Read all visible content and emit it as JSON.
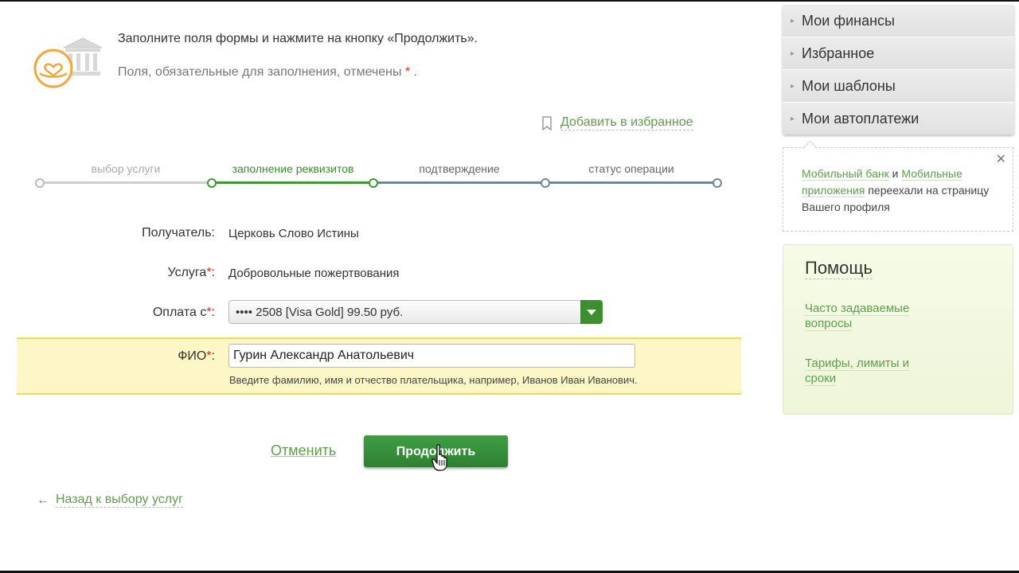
{
  "intro": {
    "line1": "Заполните поля формы и нажмите на кнопку «Продолжить».",
    "line2_prefix": "Поля, обязательные для заполнения, отмечены ",
    "line2_star": "*",
    "line2_suffix": " ."
  },
  "favorites": {
    "label": "Добавить в избранное"
  },
  "steps": [
    {
      "label": "выбор услуги",
      "state": "done"
    },
    {
      "label": "заполнение реквизитов",
      "state": "active"
    },
    {
      "label": "подтверждение",
      "state": "future"
    },
    {
      "label": "статус операции",
      "state": "future"
    }
  ],
  "form": {
    "recipient_label": "Получатель:",
    "recipient_value": "Церковь Слово Истины",
    "service_label": "Услуга",
    "service_value": "Добровольные пожертвования",
    "payment_label": "Оплата с",
    "payment_value": "•••• 2508 [Visa Gold] 99.50 руб.",
    "fio_label": "ФИО",
    "fio_value": "Гурин Александр Анатольевич",
    "fio_hint": "Введите фамилию, имя и отчество плательщика, например, Иванов Иван Иванович.",
    "required_mark": "*",
    "colon": ":"
  },
  "actions": {
    "cancel": "Отменить",
    "continue": "Продолжить",
    "back": "Назад к выбору услуг",
    "back_arrow": "←"
  },
  "side_menu": {
    "items": [
      {
        "label": "Мои финансы"
      },
      {
        "label": "Избранное"
      },
      {
        "label": "Мои шаблоны"
      },
      {
        "label": "Мои автоплатежи"
      }
    ]
  },
  "notice": {
    "close": "✕",
    "link1": "Мобильный банк",
    "and": " и ",
    "link2": "Мобильные приложения",
    "rest": " переехали на страницу Вашего профиля"
  },
  "help": {
    "title": "Помощь",
    "faq": "Часто задаваемые вопросы",
    "tariffs": "Тарифы, лимиты и сроки"
  },
  "colors": {
    "accent_green": "#3c8f2e",
    "link_green": "#5d9e4b",
    "highlight_yellow": "#fdf7c7",
    "required_red": "#e0301e"
  },
  "icons": {
    "service_logo": "bank-heart-hands-icon",
    "favorite": "bookmark-icon",
    "cursor": "hand-pointer-cursor-icon"
  }
}
